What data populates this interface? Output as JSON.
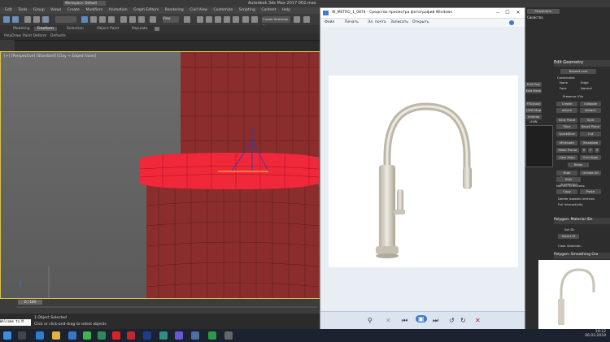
{
  "max": {
    "title": "Autodesk 3ds Max 2017    002.max",
    "workspace": "Workspace: Default",
    "menus": [
      "Edit",
      "Tools",
      "Group",
      "Views",
      "Create",
      "Modifiers",
      "Animation",
      "Graph Editors",
      "Rendering",
      "Civil View",
      "Customize",
      "Scripting",
      "Content",
      "Help"
    ],
    "create_selection_set": "Create Selection Se",
    "view_dropdown": "View",
    "ribbon_tabs": [
      "Modeling",
      "Freeform",
      "Selection",
      "Object Paint",
      "Populate"
    ],
    "ribbon_items": [
      "PolyDraw",
      "Paint Deform",
      "Defaults"
    ],
    "viewport_label": "[+] [Perspective] [Standard] [Clay + Edged Faces]",
    "timeline_slider": "0 / 100",
    "status_selected": "1 Object Selected",
    "status_hint": "Click or click-and-drag to select objects",
    "maxscript_label": "Welcome to M"
  },
  "viewer": {
    "title": "W_METRO_1_0874 - Средство просмотра фотографий Windows",
    "menu": [
      "Файл",
      "Печать",
      "Эл. почта",
      "Записать",
      "Открыть"
    ],
    "controls": {
      "zoom": "⚲",
      "delete": "✕",
      "prev": "⏮",
      "slideshow": "▣",
      "next": "⏭",
      "rotate_ccw": "↺",
      "rotate_cw": "↻",
      "delete_red": "✕"
    },
    "colors": {
      "accent": "#1e5ba8"
    }
  },
  "panel": {
    "title": "Edit Geometry",
    "repeat_last": "Repeat Last",
    "constraints_label": "Constraints",
    "constraints": [
      "None",
      "Edge",
      "Face",
      "Normal"
    ],
    "preserve_uvs": "Preserve UVs",
    "buttons": [
      "Create",
      "Collapse",
      "Attach",
      "Detach",
      "Slice Plane",
      "Split",
      "Slice",
      "Reset Plane",
      "QuickSlice",
      "Cut",
      "MSmooth",
      "Tessellate",
      "Make Planar",
      "X",
      "Y",
      "Z",
      "View Align",
      "Grid Align",
      "Relax",
      "Hide Selected",
      "Unhide All",
      "Hide Unselected"
    ],
    "named_selections": "Named Selections:",
    "copy": "Copy",
    "paste": "Paste",
    "delete_isolated": "Delete Isolated Vertices",
    "full_interactivity": "Full Interactivity",
    "poly_material": "Polygon: Material IDs",
    "set_id": "Set ID:",
    "select_id": "Select ID",
    "clear_selection": "Clear Selection",
    "smoothing": "Polygon: Smoothing Gro",
    "left_buttons": [
      "Edit Poly",
      "Edit Mesh",
      "FFD(box)",
      "UVW Map",
      "Unwrap UVW"
    ]
  },
  "taskbar": {
    "time": "19:12",
    "date": "06.03.2018",
    "right_button": "Свойства",
    "right_small": "Разделить"
  }
}
